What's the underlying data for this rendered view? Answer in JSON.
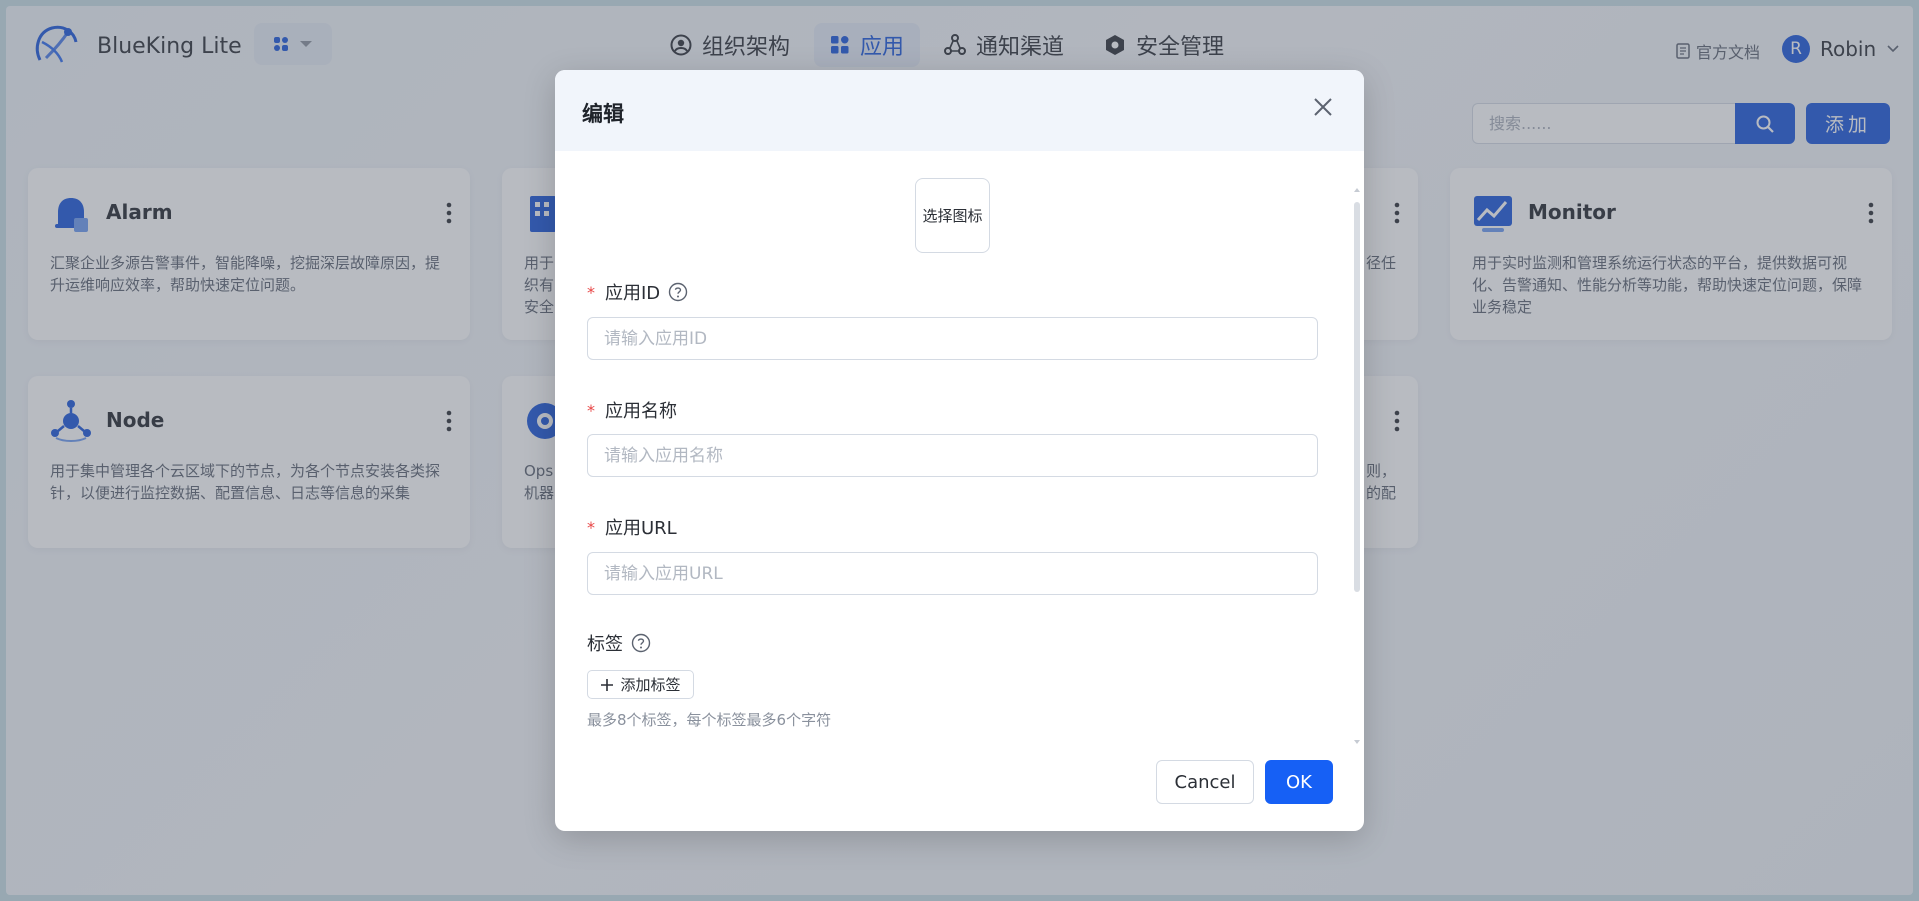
{
  "header": {
    "brand": "BlueKing Lite",
    "nav": [
      {
        "label": "组织架构",
        "icon": "user-circle-icon"
      },
      {
        "label": "应用",
        "icon": "apps-grid-icon",
        "active": true
      },
      {
        "label": "通知渠道",
        "icon": "share-nodes-icon"
      },
      {
        "label": "安全管理",
        "icon": "shield-gear-icon"
      }
    ],
    "docs_label": "官方文档",
    "user": {
      "initial": "R",
      "name": "Robin"
    }
  },
  "toolbar": {
    "search_placeholder": "搜索......",
    "add_label": "添加"
  },
  "cards": [
    {
      "title": "Alarm",
      "description": "汇聚企业多源告警事件，智能降噪，挖掘深层故障原因，提升运维响应效率，帮助快速定位问题。",
      "icon": "alarm-bell-icon"
    },
    {
      "title": "",
      "description": "用于\n织有\n安全",
      "icon": "building-icon"
    },
    {
      "title": "",
      "description": "径任",
      "icon": ""
    },
    {
      "title": "Monitor",
      "description": "用于实时监测和管理系统运行状态的平台，提供数据可视化、告警通知、性能分析等功能，帮助快速定位问题，保障业务稳定",
      "icon": "monitor-chart-icon"
    },
    {
      "title": "Node",
      "description": "用于集中管理各个云区域下的节点，为各个节点安装各类探针，以便进行监控数据、配置信息、日志等信息的采集",
      "icon": "node-hub-icon"
    },
    {
      "title": "",
      "description": "Ops\n机器",
      "icon": "ops-gauge-icon"
    },
    {
      "title": "",
      "description": "则，\n的配",
      "icon": ""
    }
  ],
  "modal": {
    "title": "编辑",
    "icon_picker_label": "选择图标",
    "fields": [
      {
        "label": "应用ID",
        "placeholder": "请输入应用ID",
        "required": true,
        "help": true
      },
      {
        "label": "应用名称",
        "placeholder": "请输入应用名称",
        "required": true
      },
      {
        "label": "应用URL",
        "placeholder": "请输入应用URL",
        "required": true
      }
    ],
    "tags_label": "标签",
    "add_tag_label": "添加标签",
    "tag_hint": "最多8个标签，每个标签最多6个字符",
    "cancel_label": "Cancel",
    "ok_label": "OK"
  },
  "colors": {
    "primary": "#1a56db",
    "ok": "#1660f5",
    "required": "#e84545"
  }
}
